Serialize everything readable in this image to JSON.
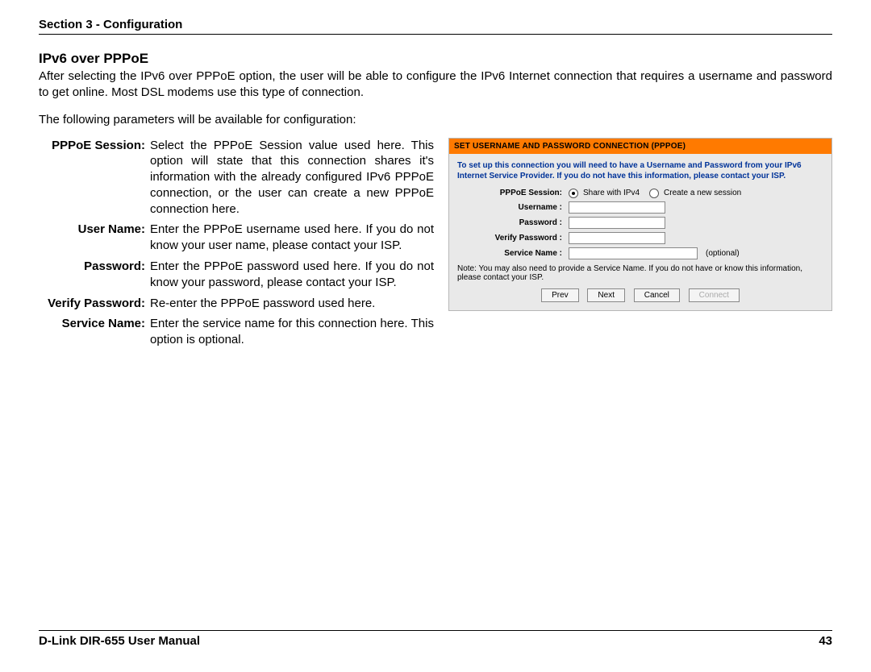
{
  "header": {
    "section": "Section 3 - Configuration"
  },
  "title": "IPv6 over PPPoE",
  "intro": "After selecting the IPv6 over PPPoE option, the user will be able to configure the IPv6 Internet connection that requires a username and password to get online. Most DSL modems use this type of connection.",
  "sub": "The following parameters will be available for configuration:",
  "definitions": [
    {
      "term": "PPPoE Session:",
      "desc": "Select the PPPoE Session value used here. This option will state that this connection shares it's information with the already configured IPv6 PPPoE connection, or the user can create a new PPPoE connection here."
    },
    {
      "term": "User Name:",
      "desc": "Enter the PPPoE username used here. If you do not know your user name, please contact your ISP."
    },
    {
      "term": "Password:",
      "desc": "Enter the PPPoE password used here. If you do not know your password, please contact your ISP."
    },
    {
      "term": "Verify Password:",
      "desc": "Re-enter the PPPoE password used here."
    },
    {
      "term": "Service Name:",
      "desc": "Enter the service name for this connection here. This option is optional."
    }
  ],
  "panel": {
    "title": "SET USERNAME AND PASSWORD CONNECTION (PPPOE)",
    "note": "To set up this connection you will need to have a Username and Password from your IPv6 Internet Service Provider. If you do not have this information, please contact your ISP.",
    "form": {
      "session_label": "PPPoE Session:",
      "session_opt1": "Share with IPv4",
      "session_opt2": "Create a new session",
      "username_label": "Username :",
      "password_label": "Password :",
      "verify_label": "Verify Password :",
      "service_label": "Service Name :",
      "optional_text": "(optional)"
    },
    "footnote": "Note: You may also need to provide a Service Name. If you do not have or know this information, please contact your ISP.",
    "buttons": {
      "prev": "Prev",
      "next": "Next",
      "cancel": "Cancel",
      "connect": "Connect"
    }
  },
  "footer": {
    "left": "D-Link DIR-655 User Manual",
    "right": "43"
  }
}
